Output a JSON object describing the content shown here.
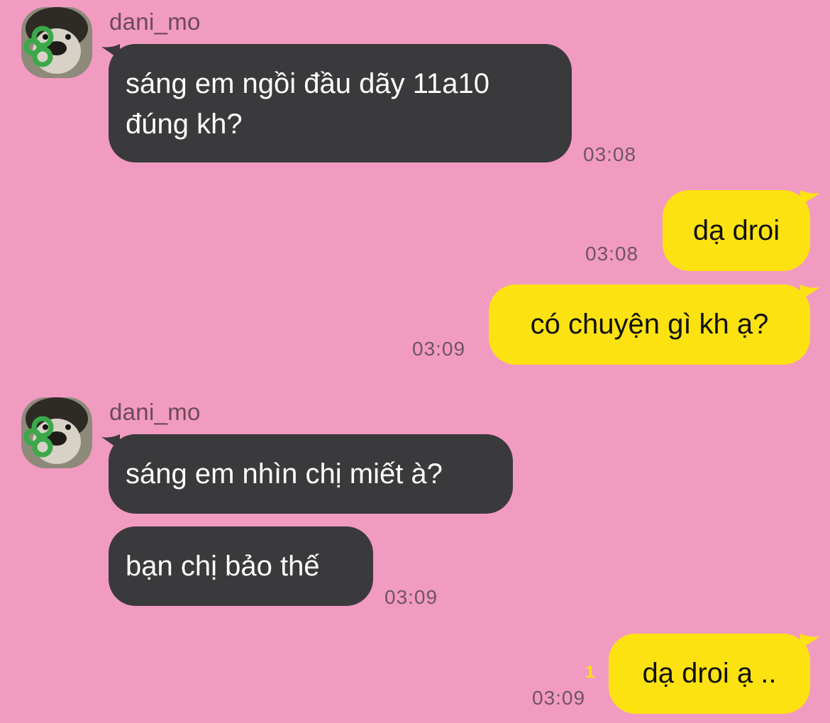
{
  "chat": {
    "colors": {
      "background": "#F29BC1",
      "incoming_bubble": "#3A3A3C",
      "outgoing_bubble": "#FDE212"
    },
    "messages": [
      {
        "direction": "in",
        "sender": "dani_mo",
        "avatar": "dog-avatar-icon",
        "text": "sáng em ngồi đầu dãy 11a10 đúng kh?",
        "time": "03:08"
      },
      {
        "direction": "out",
        "text": "dạ droi",
        "time": "03:08"
      },
      {
        "direction": "out",
        "text": "có chuyện gì kh ạ?",
        "time": "03:09"
      },
      {
        "direction": "in",
        "sender": "dani_mo",
        "avatar": "dog-avatar-icon",
        "text": "sáng em nhìn chị miết à?"
      },
      {
        "direction": "in",
        "text": "bạn chị bảo thế",
        "time": "03:09"
      },
      {
        "direction": "out",
        "text": "dạ droi ạ ..",
        "time": "03:09",
        "unread_count": "1"
      }
    ]
  }
}
